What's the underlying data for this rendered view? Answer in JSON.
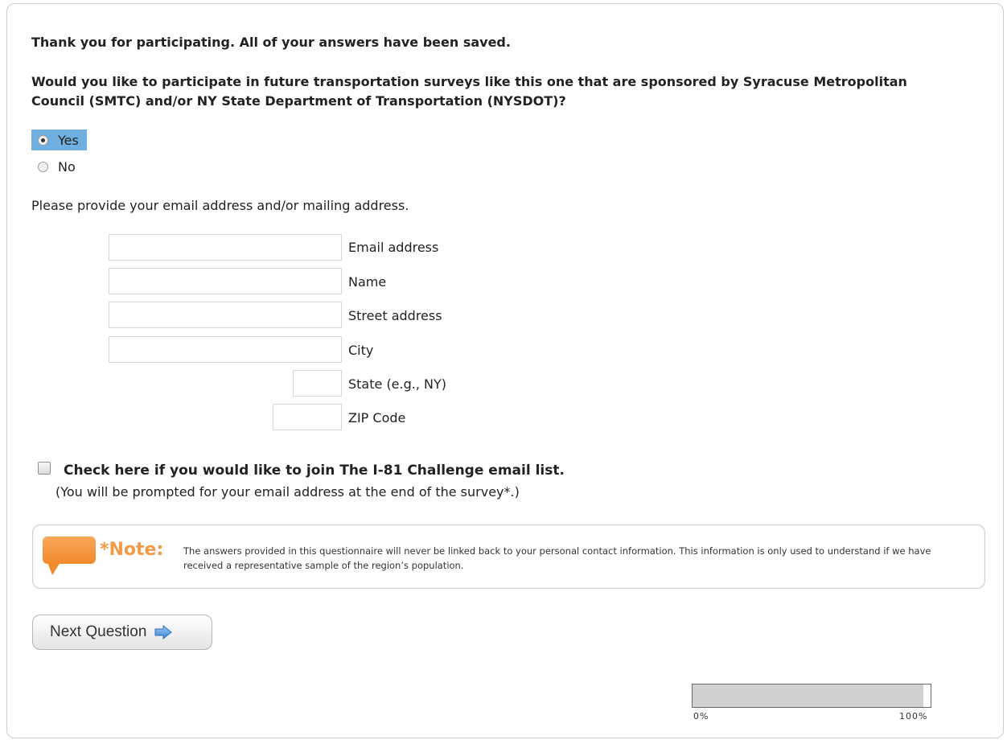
{
  "thanks_text": "Thank you for participating. All of your answers have been saved.",
  "question_text": "Would you like to participate in future transportation surveys like this one that are sponsored by Syracuse Metropolitan Council (SMTC) and/or NY State Department of Transportation (NYSDOT)?",
  "options": [
    {
      "label": "Yes",
      "selected": true
    },
    {
      "label": "No",
      "selected": false
    }
  ],
  "address_prompt": "Please provide your email address and/or mailing address.",
  "fields": {
    "email": {
      "label": "Email address",
      "value": ""
    },
    "name": {
      "label": "Name",
      "value": ""
    },
    "street": {
      "label": "Street address",
      "value": ""
    },
    "city": {
      "label": "City",
      "value": ""
    },
    "state": {
      "label": "State (e.g., NY)",
      "value": ""
    },
    "zip": {
      "label": "ZIP Code",
      "value": ""
    }
  },
  "email_list": {
    "label": "Check here if you would like to join The I-81 Challenge email list.",
    "sublabel": "(You will be prompted for your email address at the end of the survey*.)",
    "checked": false
  },
  "note": {
    "title": "*Note:",
    "text": "The answers provided in this questionnaire will never be linked back to your personal contact information. This information is only used to understand if we have received a representative sample of the region’s population.",
    "icon": "speech-bubble-icon",
    "accent_color": "#f29a45"
  },
  "next_button": {
    "label": "Next Question",
    "icon": "right-arrow-icon"
  },
  "progress": {
    "value_percent": 97,
    "min_label": "0%",
    "max_label": "100%"
  },
  "colors": {
    "selected_option_bg": "#6fb0e0"
  }
}
